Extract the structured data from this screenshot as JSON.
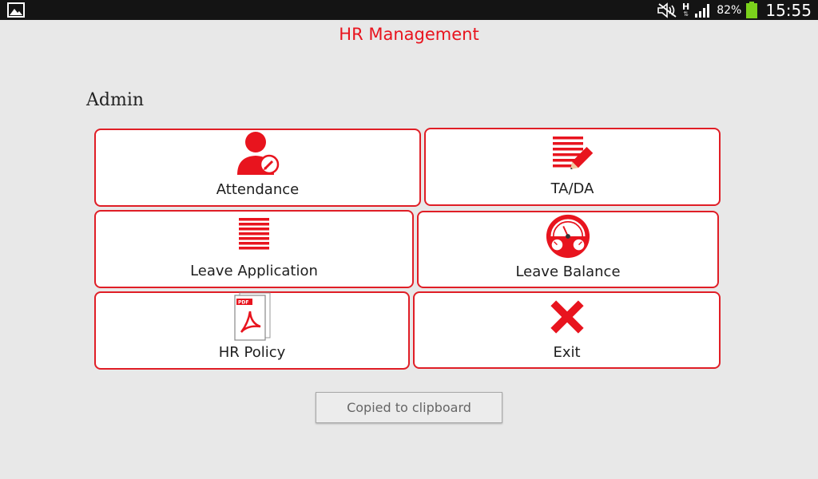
{
  "status_bar": {
    "network_type": "H",
    "battery_percent": "82%",
    "time": "15:55",
    "icons": [
      "gallery-icon",
      "mute-icon",
      "network-h-icon",
      "signal-icon",
      "battery-icon"
    ]
  },
  "app": {
    "title": "HR Management",
    "section_title": "Admin"
  },
  "menu": {
    "attendance": {
      "label": "Attendance",
      "icon": "attendance-user-icon"
    },
    "tada": {
      "label": "TA/DA",
      "icon": "document-edit-icon"
    },
    "leave_application": {
      "label": "Leave Application",
      "icon": "lines-list-icon"
    },
    "leave_balance": {
      "label": "Leave Balance",
      "icon": "gauge-icon"
    },
    "hr_policy": {
      "label": "HR Policy",
      "icon": "pdf-icon"
    },
    "exit": {
      "label": "Exit",
      "icon": "close-x-icon"
    }
  },
  "toast": {
    "text": "Copied to clipboard"
  },
  "colors": {
    "accent": "#e01e26",
    "background": "#e8e8e8",
    "status_bar": "#141414"
  }
}
